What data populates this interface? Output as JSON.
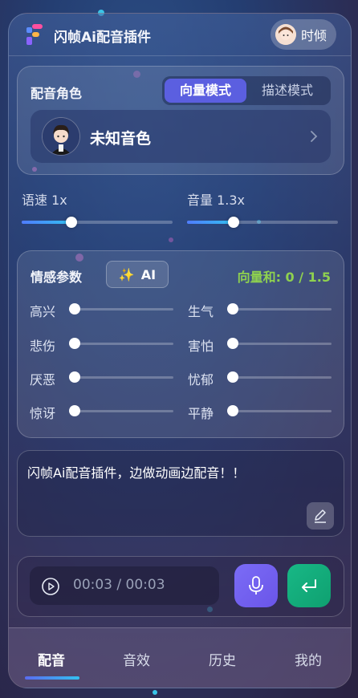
{
  "header": {
    "title": "闪帧Ai配音插件",
    "user_name": "时倾"
  },
  "voice": {
    "section_title": "配音角色",
    "modes": [
      "向量模式",
      "描述模式"
    ],
    "active_mode": "向量模式",
    "current_voice": "未知音色"
  },
  "controls": {
    "speed": {
      "label": "语速 1x",
      "value": 1,
      "fraction": 0.33
    },
    "volume": {
      "label": "音量 1.3x",
      "value": 1.3,
      "fraction": 0.31
    }
  },
  "emotion": {
    "section_title": "情感参数",
    "ai_label": "AI",
    "vector_sum_text": "向量和: 0 / 1.5",
    "items": [
      {
        "label": "高兴",
        "value": 0
      },
      {
        "label": "生气",
        "value": 0
      },
      {
        "label": "悲伤",
        "value": 0
      },
      {
        "label": "害怕",
        "value": 0
      },
      {
        "label": "厌恶",
        "value": 0
      },
      {
        "label": "忧郁",
        "value": 0
      },
      {
        "label": "惊讶",
        "value": 0
      },
      {
        "label": "平静",
        "value": 0
      }
    ]
  },
  "editor": {
    "text": "闪帧Ai配音插件，边做动画边配音！！"
  },
  "player": {
    "time": "00:03 / 00:03"
  },
  "tabs": [
    "配音",
    "音效",
    "历史",
    "我的"
  ],
  "active_tab": "配音",
  "colors": {
    "accent": "#5b5fe0",
    "vector_sum": "#8fd14f",
    "mic": "#6a55e8",
    "send": "#0fa070"
  }
}
